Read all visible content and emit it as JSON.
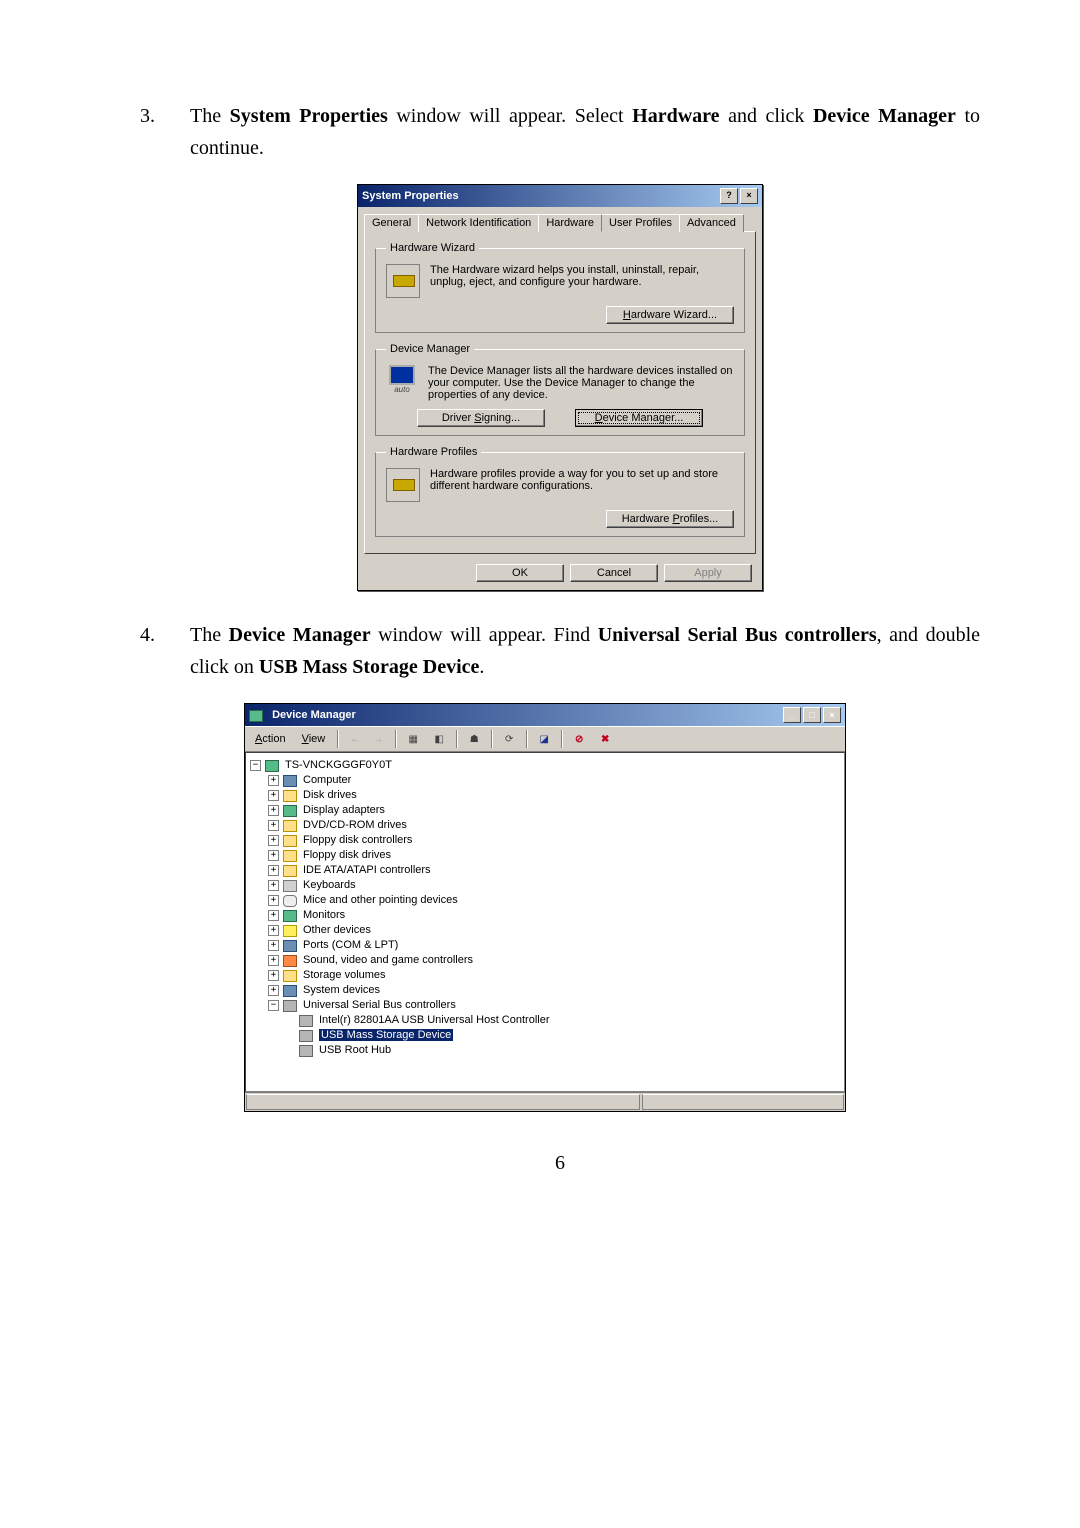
{
  "step3": {
    "num": "3.",
    "t1": "The ",
    "b1": "System Properties",
    "t2": " window will appear. Select ",
    "b2": "Hardware",
    "t3": " and click ",
    "b3": "Device Manager",
    "t4": " to continue."
  },
  "step4": {
    "num": "4.",
    "t1": "The ",
    "b1": "Device Manager",
    "t2": " window will appear. Find ",
    "b2": "Universal Serial Bus controllers",
    "t3": ", and double click on ",
    "b3": "USB Mass Storage Device",
    "t4": "."
  },
  "dlg": {
    "title": "System Properties",
    "help": "?",
    "close": "×",
    "tabs": {
      "general": "General",
      "network": "Network Identification",
      "hardware": "Hardware",
      "profiles": "User Profiles",
      "advanced": "Advanced"
    },
    "hw_wizard": {
      "legend": "Hardware Wizard",
      "desc": "The Hardware wizard helps you install, uninstall, repair, unplug, eject, and configure your hardware.",
      "btn": "Hardware Wizard..."
    },
    "dm": {
      "legend": "Device Manager",
      "desc": "The Device Manager lists all the hardware devices installed on your computer. Use the Device Manager to change the properties of any device.",
      "btn_sign": "Driver Signing...",
      "btn_dm": "Device Manager..."
    },
    "hp": {
      "legend": "Hardware Profiles",
      "desc": "Hardware profiles provide a way for you to set up and store different hardware configurations.",
      "btn": "Hardware Profiles..."
    },
    "ok": "OK",
    "cancel": "Cancel",
    "apply": "Apply"
  },
  "win": {
    "title": "Device Manager",
    "menu": {
      "action": "Action",
      "view": "View"
    },
    "root": "TS-VNCKGGGF0Y0T",
    "nodes": [
      "Computer",
      "Disk drives",
      "Display adapters",
      "DVD/CD-ROM drives",
      "Floppy disk controllers",
      "Floppy disk drives",
      "IDE ATA/ATAPI controllers",
      "Keyboards",
      "Mice and other pointing devices",
      "Monitors",
      "Other devices",
      "Ports (COM & LPT)",
      "Sound, video and game controllers",
      "Storage volumes",
      "System devices",
      "Universal Serial Bus controllers"
    ],
    "usb_children": [
      "Intel(r) 82801AA USB Universal Host Controller",
      "USB Mass Storage Device",
      "USB Root Hub"
    ]
  },
  "pagenum": "6"
}
